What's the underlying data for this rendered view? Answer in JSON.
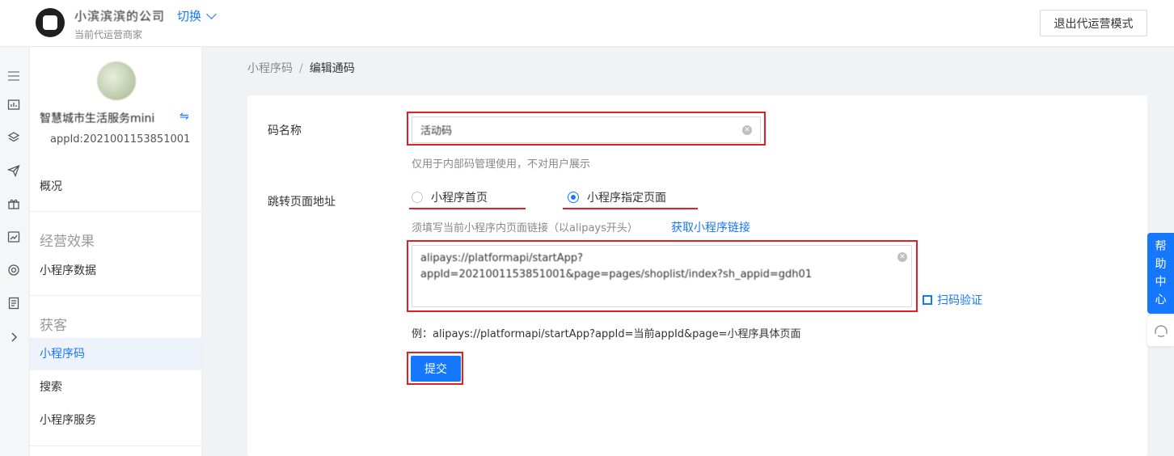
{
  "header": {
    "merchant_name": "小滨滨滨的公司",
    "switch_label": "切换",
    "merchant_sub": "当前代运营商家",
    "exit_label": "退出代运营模式"
  },
  "iconbar": [
    "menu-icon",
    "dashboard-icon",
    "layers-icon",
    "send-icon",
    "gift-icon",
    "chart-icon",
    "target-icon",
    "document-icon",
    "chevron-right-icon"
  ],
  "sidebar": {
    "app_name": "智慧城市生活服务mini",
    "appid": "appId:2021001153851001",
    "items": [
      {
        "label": "概况"
      },
      {
        "group": "经营效果"
      },
      {
        "label": "小程序数据"
      },
      {
        "group": "获客"
      },
      {
        "label": "小程序码",
        "active": true
      },
      {
        "label": "搜索"
      },
      {
        "label": "小程序服务"
      }
    ]
  },
  "breadcrumb": {
    "root": "小程序码",
    "sep": "/",
    "current": "编辑通码"
  },
  "form": {
    "name_label": "码名称",
    "name_value": "活动码",
    "name_hint": "仅用于内部码管理使用，不对用户展示",
    "jump_label": "跳转页面地址",
    "radio_home": "小程序首页",
    "radio_specific": "小程序指定页面",
    "link_hint": "须填写当前小程序内页面链接（以alipays开头）",
    "get_link": "获取小程序链接",
    "url_value": "alipays://platformapi/startApp?\nappId=2021001153851001&page=pages/shoplist/index?sh_appid=gdh01",
    "scan_verify": "扫码验证",
    "example": "例：alipays://platformapi/startApp?appId=当前appId&page=小程序具体页面",
    "submit": "提交"
  },
  "help": {
    "chars": [
      "帮",
      "助",
      "中",
      "心"
    ]
  },
  "colors": {
    "accent": "#1677ff",
    "annotation": "#e11f26"
  }
}
